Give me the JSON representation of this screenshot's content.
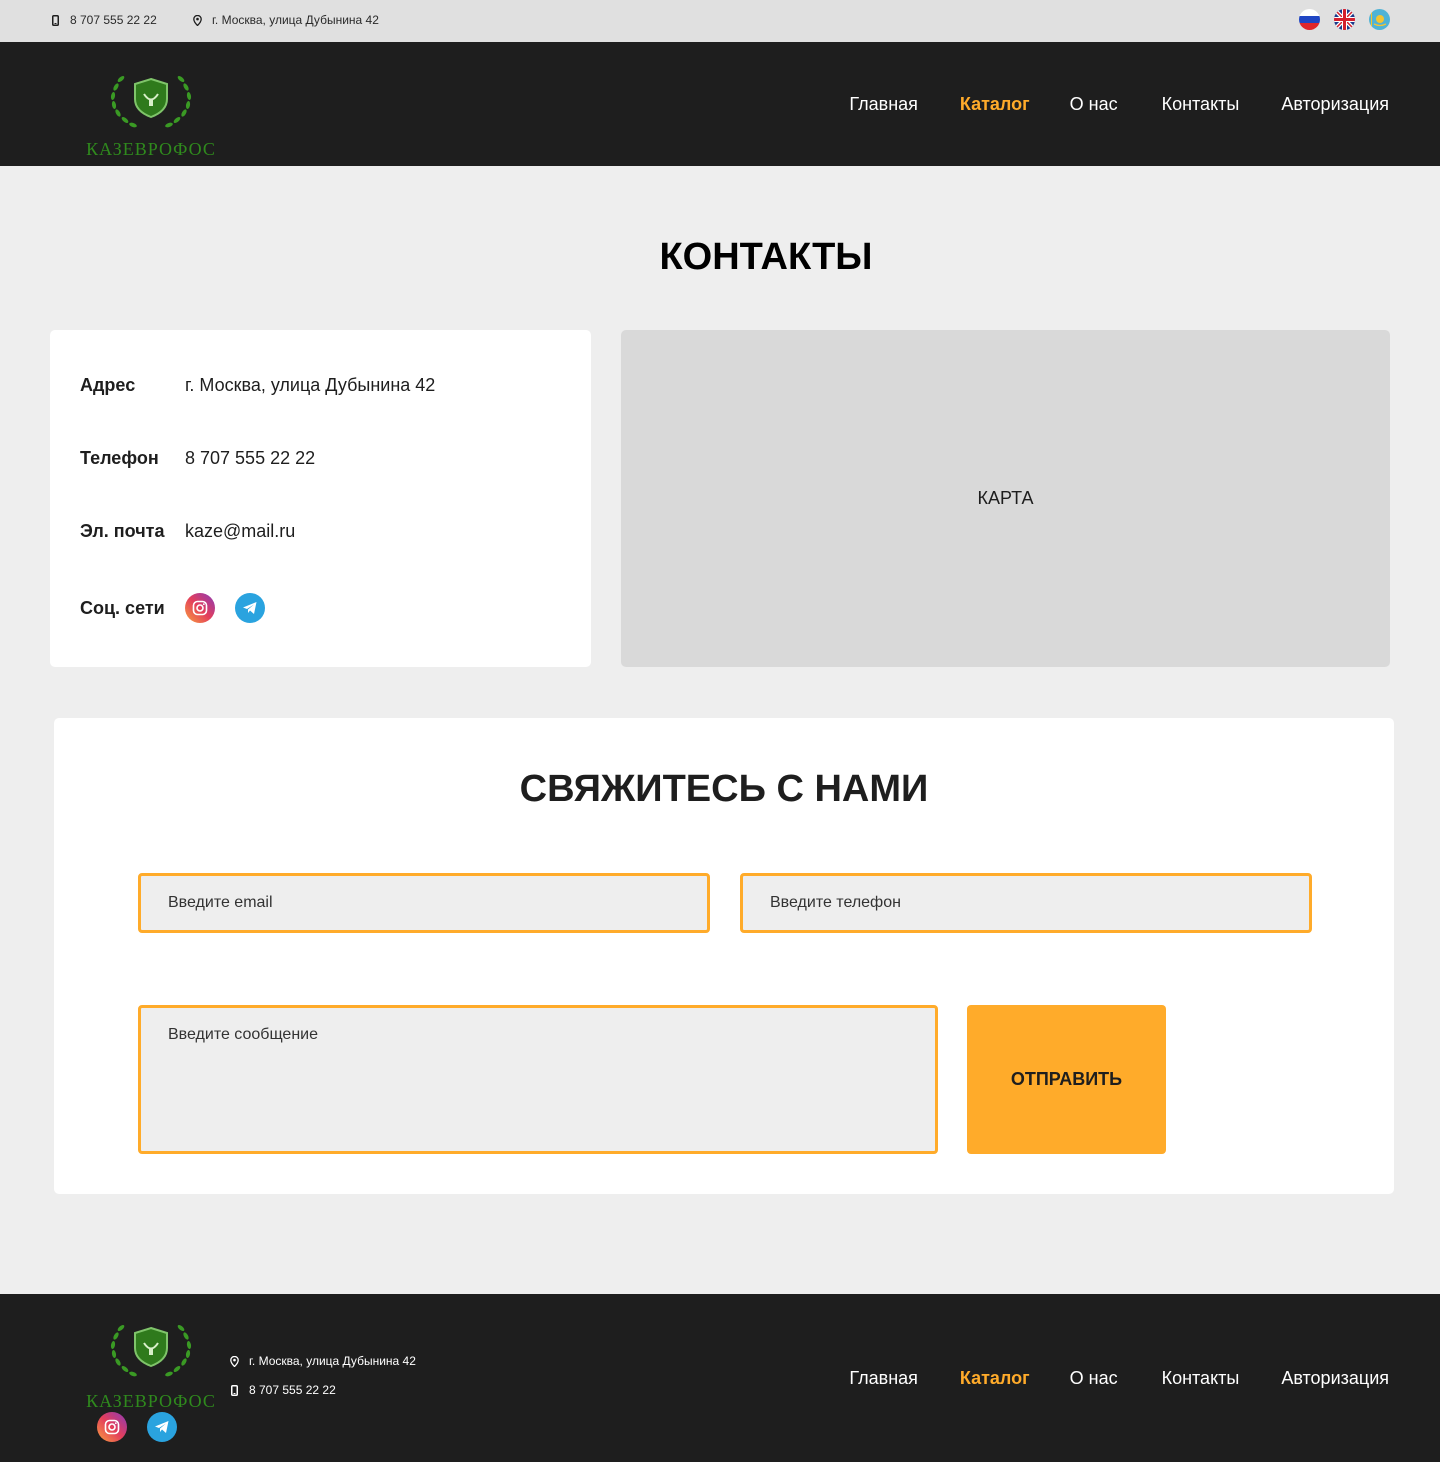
{
  "topbar": {
    "phone": "8 707 555 22 22",
    "address": "г. Москва, улица Дубынина 42",
    "languages": [
      "ru-flag-icon",
      "en-flag-icon",
      "kz-flag-icon"
    ]
  },
  "brand": {
    "name": "КАЗЕВРОФОС",
    "color": "#2f8a1d"
  },
  "nav": {
    "items": [
      {
        "label": "Главная",
        "active": false
      },
      {
        "label": "Каталог",
        "active": true
      },
      {
        "label": "О нас",
        "active": false
      },
      {
        "label": "Контакты",
        "active": false
      },
      {
        "label": "Авторизация",
        "active": false
      }
    ]
  },
  "page": {
    "title": "КОНТАКТЫ"
  },
  "contacts": {
    "address_label": "Адрес",
    "address_value": "г. Москва, улица Дубынина 42",
    "phone_label": "Телефон",
    "phone_value": "8 707 555 22 22",
    "email_label": "Эл. почта",
    "email_value": "kaze@mail.ru",
    "social_label": "Соц. сети",
    "social_icons": [
      "instagram-icon",
      "telegram-icon"
    ]
  },
  "map": {
    "label": "КАРТА"
  },
  "form": {
    "title": "СВЯЖИТЕСЬ С НАМИ",
    "email_placeholder": "Введите email",
    "phone_placeholder": "Введите телефон",
    "message_placeholder": "Введите сообщение",
    "submit_label": "ОТПРАВИТЬ"
  },
  "footer": {
    "address": "г. Москва, улица Дубынина 42",
    "phone": "8 707 555 22 22"
  },
  "colors": {
    "accent": "#ffab2a",
    "dark": "#1e1e1e",
    "background": "#eeeeee",
    "map_placeholder": "#d9d9d9"
  }
}
